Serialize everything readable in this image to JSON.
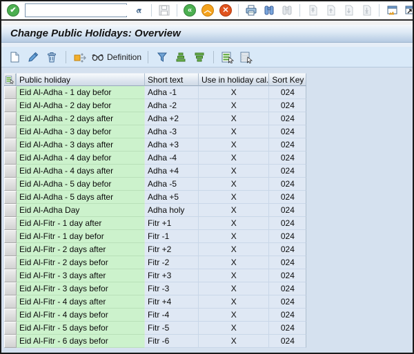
{
  "window": {
    "title": "Change Public Holidays: Overview"
  },
  "sys_toolbar": {
    "command_field": {
      "value": "",
      "placeholder": ""
    },
    "buttons": [
      "enter",
      "save",
      "back",
      "exit",
      "cancel",
      "print",
      "find",
      "find-next",
      "first-page",
      "previous-page",
      "next-page",
      "last-page",
      "new-session",
      "create-shortcut",
      "help",
      "customize-local-layout"
    ]
  },
  "app_toolbar": {
    "definition_label": "Definition",
    "buttons": [
      "create",
      "change",
      "delete",
      "choose-detail",
      "definition",
      "set-filter",
      "sort-ascending",
      "sort-descending",
      "select-all",
      "deselect-all"
    ]
  },
  "colors": {
    "holiday_cell_green": "#ccf2cc",
    "data_cell_blue": "#dfe8f4",
    "app_toolbar_bg": "#d9e9f8",
    "main_bg": "#d5e1ef",
    "enter_green": "#4caf50",
    "exit_orange": "#f5a31e",
    "cancel_red": "#e0531e"
  },
  "table": {
    "headers": [
      "Public holiday",
      "Short text",
      "Use in holiday cal.",
      "Sort Key"
    ],
    "rows": [
      {
        "holiday": "Eid Al-Adha - 1 day befor",
        "short_text": "Adha -1",
        "use_in_cal": "X",
        "sort_key": "024"
      },
      {
        "holiday": "Eid Al-Adha - 2 day befor",
        "short_text": "Adha -2",
        "use_in_cal": "X",
        "sort_key": "024"
      },
      {
        "holiday": "Eid Al-Adha - 2 days after",
        "short_text": "Adha +2",
        "use_in_cal": "X",
        "sort_key": "024"
      },
      {
        "holiday": "Eid Al-Adha - 3 day befor",
        "short_text": "Adha -3",
        "use_in_cal": "X",
        "sort_key": "024"
      },
      {
        "holiday": "Eid Al-Adha - 3 days after",
        "short_text": "Adha +3",
        "use_in_cal": "X",
        "sort_key": "024"
      },
      {
        "holiday": "Eid Al-Adha - 4 day befor",
        "short_text": "Adha -4",
        "use_in_cal": "X",
        "sort_key": "024"
      },
      {
        "holiday": "Eid Al-Adha - 4 days after",
        "short_text": "Adha +4",
        "use_in_cal": "X",
        "sort_key": "024"
      },
      {
        "holiday": "Eid Al-Adha - 5 day befor",
        "short_text": "Adha -5",
        "use_in_cal": "X",
        "sort_key": "024"
      },
      {
        "holiday": "Eid Al-Adha - 5 days after",
        "short_text": "Adha +5",
        "use_in_cal": "X",
        "sort_key": "024"
      },
      {
        "holiday": "Eid Al-Adha Day",
        "short_text": "Adha holy",
        "use_in_cal": "X",
        "sort_key": "024"
      },
      {
        "holiday": "Eid Al-Fitr - 1 day after",
        "short_text": "Fitr +1",
        "use_in_cal": "X",
        "sort_key": "024"
      },
      {
        "holiday": "Eid Al-Fitr - 1 day befor",
        "short_text": "Fitr -1",
        "use_in_cal": "X",
        "sort_key": "024"
      },
      {
        "holiday": "Eid Al-Fitr - 2 days after",
        "short_text": "Fitr +2",
        "use_in_cal": "X",
        "sort_key": "024"
      },
      {
        "holiday": "Eid Al-Fitr - 2 days befor",
        "short_text": "Fitr -2",
        "use_in_cal": "X",
        "sort_key": "024"
      },
      {
        "holiday": "Eid Al-Fitr - 3 days after",
        "short_text": "Fitr +3",
        "use_in_cal": "X",
        "sort_key": "024"
      },
      {
        "holiday": "Eid Al-Fitr - 3 days befor",
        "short_text": "Fitr -3",
        "use_in_cal": "X",
        "sort_key": "024"
      },
      {
        "holiday": "Eid Al-Fitr - 4 days after",
        "short_text": "Fitr +4",
        "use_in_cal": "X",
        "sort_key": "024"
      },
      {
        "holiday": "Eid Al-Fitr - 4 days befor",
        "short_text": "Fitr -4",
        "use_in_cal": "X",
        "sort_key": "024"
      },
      {
        "holiday": "Eid Al-Fitr - 5 days befor",
        "short_text": "Fitr -5",
        "use_in_cal": "X",
        "sort_key": "024"
      },
      {
        "holiday": "Eid Al-Fitr - 6 days befor",
        "short_text": "Fitr -6",
        "use_in_cal": "X",
        "sort_key": "024"
      }
    ]
  }
}
